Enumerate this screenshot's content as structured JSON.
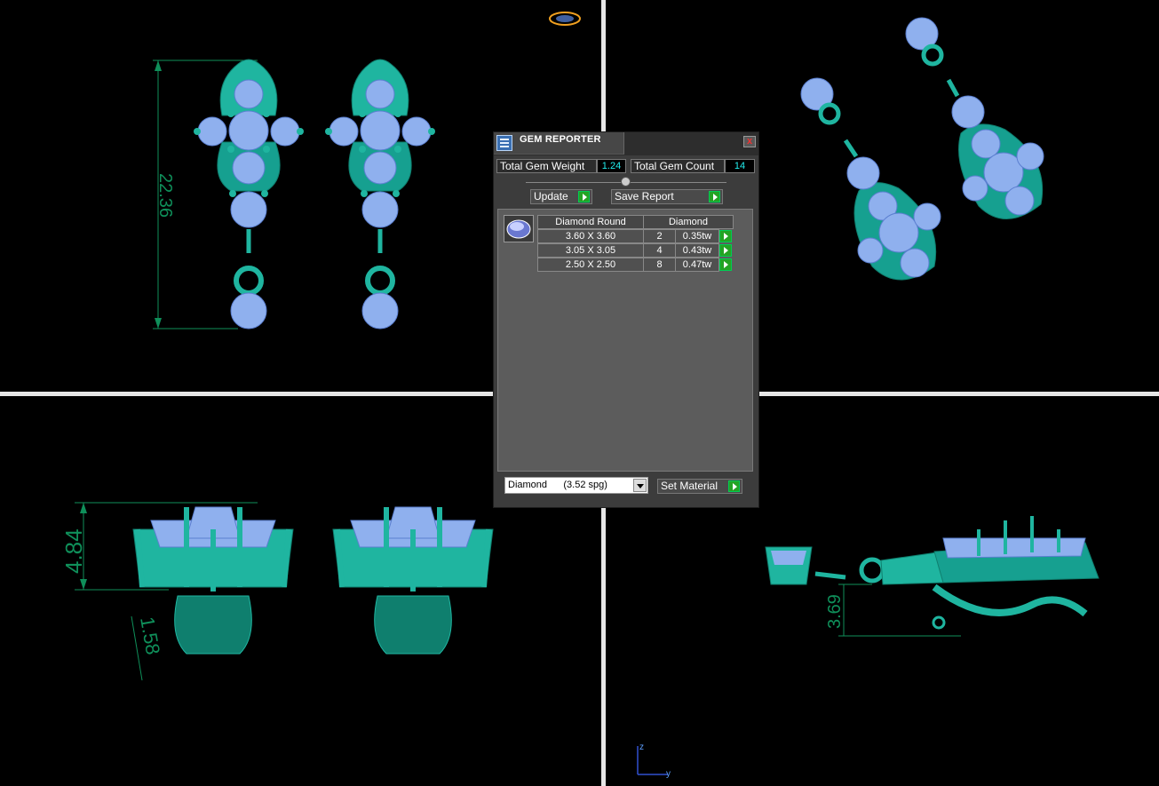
{
  "dialog": {
    "title": "GEM REPORTER",
    "close_glyph": "x",
    "total_weight_label": "Total Gem Weight",
    "total_weight_value": "1.24",
    "total_count_label": "Total Gem Count",
    "total_count_value": "14",
    "update_label": "Update",
    "save_report_label": "Save Report",
    "table": {
      "headers": [
        "Diamond Round",
        "Diamond"
      ],
      "rows": [
        {
          "size": "3.60 X 3.60",
          "count": "2",
          "weight": "0.35tw"
        },
        {
          "size": "3.05 X 3.05",
          "count": "4",
          "weight": "0.43tw"
        },
        {
          "size": "2.50 X 2.50",
          "count": "8",
          "weight": "0.47tw"
        }
      ]
    },
    "material_select": "Diamond      (3.52 spg)",
    "set_material_label": "Set Material"
  },
  "dimensions": {
    "front_height": "22.36",
    "left_height": "4.84",
    "left_depth": "1.58",
    "right_height": "3.69"
  },
  "axis": {
    "z": "z",
    "y": "y"
  },
  "colors": {
    "metal": "#1fb5a0",
    "metal_dark": "#0f7f6e",
    "gem": "#8fb0ee",
    "dimension": "#0f8f5a",
    "background": "#000000"
  }
}
